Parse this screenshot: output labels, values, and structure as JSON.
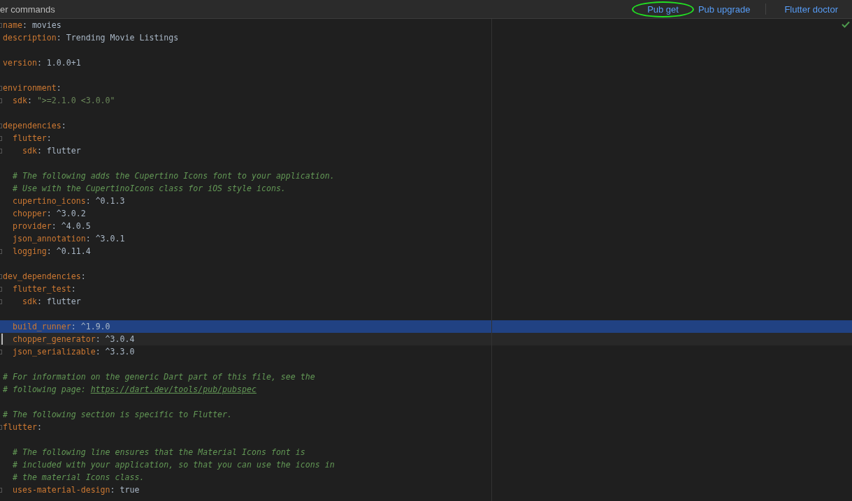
{
  "header": {
    "title": "er commands",
    "actions": [
      {
        "label": "Pub get",
        "circled": true
      },
      {
        "label": "Pub upgrade",
        "circled": false
      },
      {
        "label": "Flutter doctor",
        "circled": false
      }
    ]
  },
  "editor": {
    "lines": [
      {
        "fold": true,
        "selected": false,
        "caret": false,
        "segments": [
          {
            "kind": "key",
            "text": "name"
          },
          {
            "kind": "punct",
            "text": ": "
          },
          {
            "kind": "value",
            "text": "movies"
          }
        ]
      },
      {
        "fold": false,
        "selected": false,
        "caret": false,
        "segments": [
          {
            "kind": "key",
            "text": "description"
          },
          {
            "kind": "punct",
            "text": ": "
          },
          {
            "kind": "value",
            "text": "Trending Movie Listings"
          }
        ]
      },
      {
        "fold": false,
        "selected": false,
        "caret": false
      },
      {
        "fold": false,
        "selected": false,
        "caret": false,
        "segments": [
          {
            "kind": "key",
            "text": "version"
          },
          {
            "kind": "punct",
            "text": ": "
          },
          {
            "kind": "value",
            "text": "1.0.0+1"
          }
        ]
      },
      {
        "fold": false,
        "selected": false,
        "caret": false
      },
      {
        "fold": true,
        "selected": false,
        "caret": false,
        "segments": [
          {
            "kind": "key",
            "text": "environment"
          },
          {
            "kind": "punct",
            "text": ":"
          }
        ]
      },
      {
        "fold": true,
        "selected": false,
        "caret": false,
        "segments": [
          {
            "kind": "key",
            "text": "  sdk"
          },
          {
            "kind": "punct",
            "text": ": "
          },
          {
            "kind": "string",
            "text": "\">=2.1.0 <3.0.0\""
          }
        ]
      },
      {
        "fold": false,
        "selected": false,
        "caret": false
      },
      {
        "fold": true,
        "selected": false,
        "caret": false,
        "segments": [
          {
            "kind": "key",
            "text": "dependencies"
          },
          {
            "kind": "punct",
            "text": ":"
          }
        ]
      },
      {
        "fold": true,
        "selected": false,
        "caret": false,
        "segments": [
          {
            "kind": "key",
            "text": "  flutter"
          },
          {
            "kind": "punct",
            "text": ":"
          }
        ]
      },
      {
        "fold": true,
        "selected": false,
        "caret": false,
        "segments": [
          {
            "kind": "key",
            "text": "    sdk"
          },
          {
            "kind": "punct",
            "text": ": "
          },
          {
            "kind": "value",
            "text": "flutter"
          }
        ]
      },
      {
        "fold": false,
        "selected": false,
        "caret": false
      },
      {
        "fold": false,
        "selected": false,
        "caret": false,
        "segments": [
          {
            "kind": "comment",
            "text": "  # The following adds the Cupertino Icons font to your application."
          }
        ]
      },
      {
        "fold": false,
        "selected": false,
        "caret": false,
        "segments": [
          {
            "kind": "comment",
            "text": "  # Use with the CupertinoIcons class for iOS style icons."
          }
        ]
      },
      {
        "fold": false,
        "selected": false,
        "caret": false,
        "segments": [
          {
            "kind": "key",
            "text": "  cupertino_icons"
          },
          {
            "kind": "punct",
            "text": ": "
          },
          {
            "kind": "value",
            "text": "^0.1.3"
          }
        ]
      },
      {
        "fold": false,
        "selected": false,
        "caret": false,
        "segments": [
          {
            "kind": "key",
            "text": "  chopper"
          },
          {
            "kind": "punct",
            "text": ": "
          },
          {
            "kind": "value",
            "text": "^3.0.2"
          }
        ]
      },
      {
        "fold": false,
        "selected": false,
        "caret": false,
        "segments": [
          {
            "kind": "key",
            "text": "  provider"
          },
          {
            "kind": "punct",
            "text": ": "
          },
          {
            "kind": "value",
            "text": "^4.0.5"
          }
        ]
      },
      {
        "fold": false,
        "selected": false,
        "caret": false,
        "segments": [
          {
            "kind": "key",
            "text": "  json_annotation"
          },
          {
            "kind": "punct",
            "text": ": "
          },
          {
            "kind": "value",
            "text": "^3.0.1"
          }
        ]
      },
      {
        "fold": true,
        "selected": false,
        "caret": false,
        "segments": [
          {
            "kind": "key",
            "text": "  logging"
          },
          {
            "kind": "punct",
            "text": ": "
          },
          {
            "kind": "value",
            "text": "^0.11.4"
          }
        ]
      },
      {
        "fold": false,
        "selected": false,
        "caret": false
      },
      {
        "fold": true,
        "selected": false,
        "caret": false,
        "segments": [
          {
            "kind": "key",
            "text": "dev_dependencies"
          },
          {
            "kind": "punct",
            "text": ":"
          }
        ]
      },
      {
        "fold": true,
        "selected": false,
        "caret": false,
        "segments": [
          {
            "kind": "key",
            "text": "  flutter_test"
          },
          {
            "kind": "punct",
            "text": ":"
          }
        ]
      },
      {
        "fold": true,
        "selected": false,
        "caret": false,
        "segments": [
          {
            "kind": "key",
            "text": "    sdk"
          },
          {
            "kind": "punct",
            "text": ": "
          },
          {
            "kind": "value",
            "text": "flutter"
          }
        ]
      },
      {
        "fold": false,
        "selected": false,
        "caret": false
      },
      {
        "fold": false,
        "selected": true,
        "caret": false,
        "segments": [
          {
            "kind": "key",
            "text": "  build_runner"
          },
          {
            "kind": "punct",
            "text": ": "
          },
          {
            "kind": "value",
            "text": "^1.9.0"
          }
        ]
      },
      {
        "fold": false,
        "selected": false,
        "caret": true,
        "segments": [
          {
            "kind": "key",
            "text": "  chopper_generator"
          },
          {
            "kind": "punct",
            "text": ": "
          },
          {
            "kind": "value",
            "text": "^3.0.4"
          }
        ]
      },
      {
        "fold": true,
        "selected": false,
        "caret": false,
        "segments": [
          {
            "kind": "key",
            "text": "  json_serializable"
          },
          {
            "kind": "punct",
            "text": ": "
          },
          {
            "kind": "value",
            "text": "^3.3.0"
          }
        ]
      },
      {
        "fold": false,
        "selected": false,
        "caret": false
      },
      {
        "fold": false,
        "selected": false,
        "caret": false,
        "segments": [
          {
            "kind": "comment",
            "text": "# For information on the generic Dart part of this file, see the"
          }
        ]
      },
      {
        "fold": false,
        "selected": false,
        "caret": false,
        "segments": [
          {
            "kind": "comment",
            "text": "# following page: "
          },
          {
            "kind": "link",
            "text": "https://dart.dev/tools/pub/pubspec"
          }
        ]
      },
      {
        "fold": false,
        "selected": false,
        "caret": false
      },
      {
        "fold": false,
        "selected": false,
        "caret": false,
        "segments": [
          {
            "kind": "comment",
            "text": "# The following section is specific to Flutter."
          }
        ]
      },
      {
        "fold": true,
        "selected": false,
        "caret": false,
        "segments": [
          {
            "kind": "key",
            "text": "flutter"
          },
          {
            "kind": "punct",
            "text": ":"
          }
        ]
      },
      {
        "fold": false,
        "selected": false,
        "caret": false
      },
      {
        "fold": false,
        "selected": false,
        "caret": false,
        "segments": [
          {
            "kind": "comment",
            "text": "  # The following line ensures that the Material Icons font is"
          }
        ]
      },
      {
        "fold": false,
        "selected": false,
        "caret": false,
        "segments": [
          {
            "kind": "comment",
            "text": "  # included with your application, so that you can use the icons in"
          }
        ]
      },
      {
        "fold": false,
        "selected": false,
        "caret": false,
        "segments": [
          {
            "kind": "comment",
            "text": "  # the material Icons class."
          }
        ]
      },
      {
        "fold": true,
        "selected": false,
        "caret": false,
        "segments": [
          {
            "kind": "key",
            "text": "  uses-material-design"
          },
          {
            "kind": "punct",
            "text": ": "
          },
          {
            "kind": "value",
            "text": "true"
          }
        ]
      }
    ]
  }
}
